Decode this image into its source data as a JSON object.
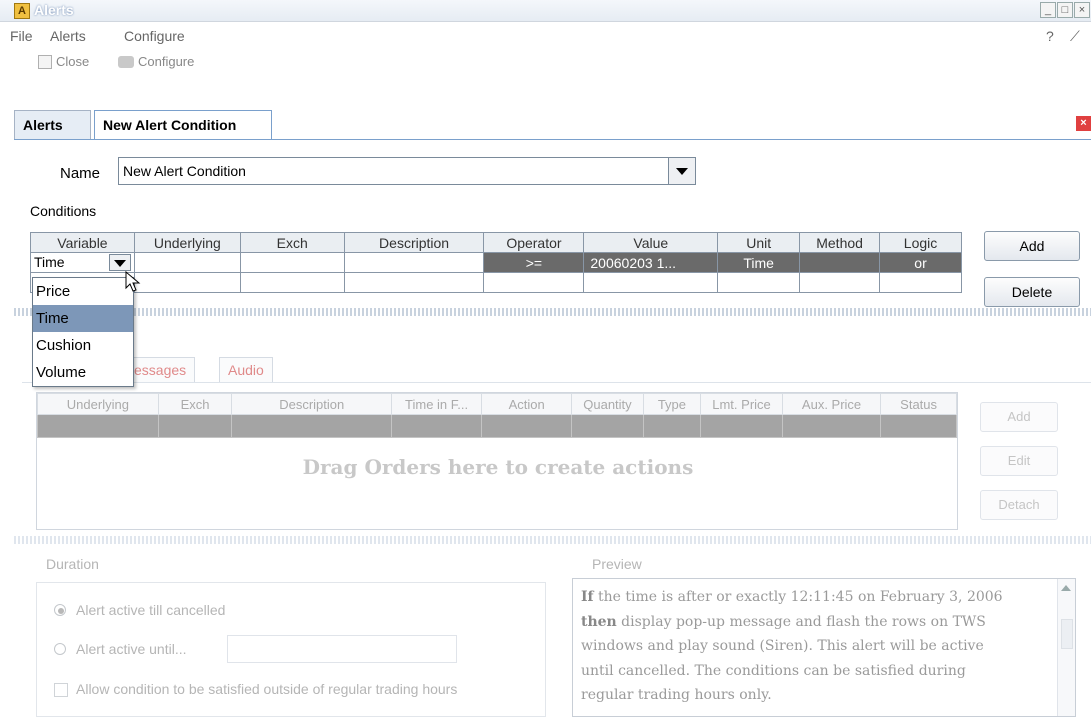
{
  "window": {
    "title": "Alerts",
    "app_icon": "A",
    "min": "_",
    "max": "□",
    "close": "×"
  },
  "menu": {
    "file": "File",
    "alerts": "Alerts",
    "configure": "Configure",
    "help": "?",
    "pin": "⟋"
  },
  "toolbar": {
    "close_label": "Close",
    "configure_label": "Configure"
  },
  "tabs": {
    "alerts": "Alerts",
    "new_alert": "New Alert Condition",
    "close_glyph": "×"
  },
  "form": {
    "name_label": "Name",
    "name_value": "New Alert Condition",
    "conditions_label": "Conditions"
  },
  "conditions_table": {
    "headers": [
      "Variable",
      "Underlying",
      "Exch",
      "Description",
      "Operator",
      "Value",
      "Unit",
      "Method",
      "Logic"
    ],
    "row1": {
      "variable": "Time",
      "operator": ">=",
      "value": "20060203 1...",
      "unit": "Time",
      "logic": "or"
    }
  },
  "buttons": {
    "add": "Add",
    "delete": "Delete"
  },
  "variable_options": [
    "Price",
    "Time",
    "Cushion",
    "Volume"
  ],
  "variable_selected_index": 1,
  "lower_tabs": {
    "messages": "essages",
    "audio": "Audio"
  },
  "orders": {
    "headers": [
      "Underlying",
      "Exch",
      "Description",
      "Time in F...",
      "Action",
      "Quantity",
      "Type",
      "Lmt. Price",
      "Aux. Price",
      "Status"
    ],
    "drag_message": "Drag Orders here to create actions",
    "add": "Add",
    "edit": "Edit",
    "detach": "Detach"
  },
  "duration": {
    "title": "Duration",
    "option1": "Alert active till cancelled",
    "option2": "Alert active until...",
    "checkbox": "Allow condition to be satisfied outside of regular trading hours"
  },
  "preview": {
    "title": "Preview",
    "if_word": "If",
    "line1": " the time is after or exactly 12:11:45 on February 3, 2006",
    "then_word": "then",
    "line2": " display pop-up message and flash the rows on TWS",
    "line3": "windows and play sound (Siren). This alert will be active",
    "line4": "until cancelled. The conditions can be satisfied during",
    "line5": "regular trading hours only."
  }
}
